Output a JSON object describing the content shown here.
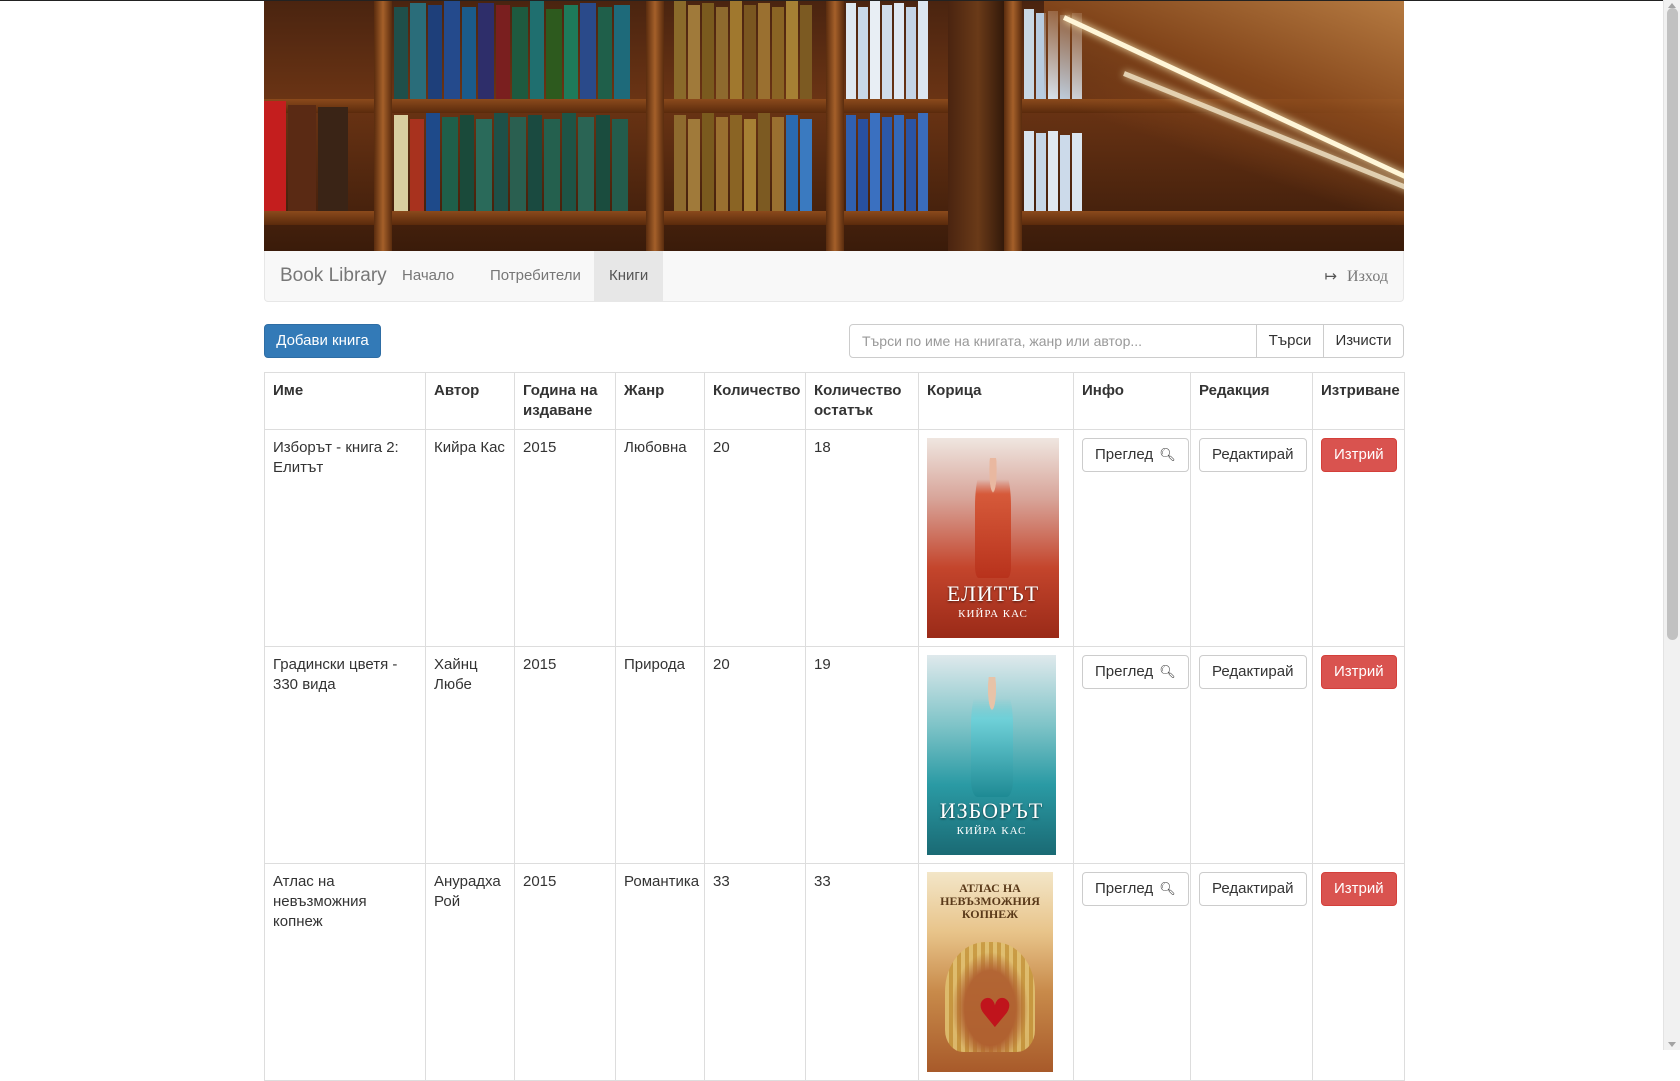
{
  "navbar": {
    "brand": "Book Library",
    "links": [
      "Начало",
      "Потребители",
      "Книги"
    ],
    "active": "Книги",
    "logout_label": "Изход",
    "logout_icon": "log-out-icon"
  },
  "toolbar": {
    "add_label": "Добави книга",
    "search_placeholder": "Търси по име на книгата, жанр или автор...",
    "search_value": "",
    "search_label": "Търси",
    "clear_label": "Изчисти"
  },
  "table": {
    "headers": [
      "Име",
      "Автор",
      "Година на издаване",
      "Жанр",
      "Количество",
      "Количество остатък",
      "Корица",
      "Инфо",
      "Редакция",
      "Изтриване"
    ],
    "rows": [
      {
        "name": "Изборът - книга 2: Елитът",
        "author": "Кийра Кас",
        "year": "2015",
        "genre": "Любовна",
        "quantity": "20",
        "remaining": "18",
        "cover_title": "ЕЛИТЪТ",
        "cover_author": "КИЙРА КАС",
        "cover_top": "",
        "view_label": "Преглед",
        "edit_label": "Редактирай",
        "delete_label": "Изтрий"
      },
      {
        "name": "Градински цветя - 330 вида",
        "author": "Хайнц Любе",
        "year": "2015",
        "genre": "Природа",
        "quantity": "20",
        "remaining": "19",
        "cover_title": "ИЗБОРЪТ",
        "cover_author": "КИЙРА КАС",
        "cover_top": "",
        "view_label": "Преглед",
        "edit_label": "Редактирай",
        "delete_label": "Изтрий"
      },
      {
        "name": "Атлас на невъзможния копнеж",
        "author": "Анурадха Рой",
        "year": "2015",
        "genre": "Романтика",
        "quantity": "33",
        "remaining": "33",
        "cover_title": "",
        "cover_author": "",
        "cover_top": "АТЛАС НА НЕВЪЗМОЖНИЯ КОПНЕЖ",
        "view_label": "Преглед",
        "edit_label": "Редактирай",
        "delete_label": "Изтрий"
      }
    ]
  },
  "icons": {
    "view": "zoom-in-icon",
    "logout": "log-out-icon"
  },
  "colors": {
    "primary": "#337ab7",
    "danger": "#d9534f",
    "navbar_bg": "#f8f8f8",
    "nav_active_bg": "#e7e7e7"
  }
}
